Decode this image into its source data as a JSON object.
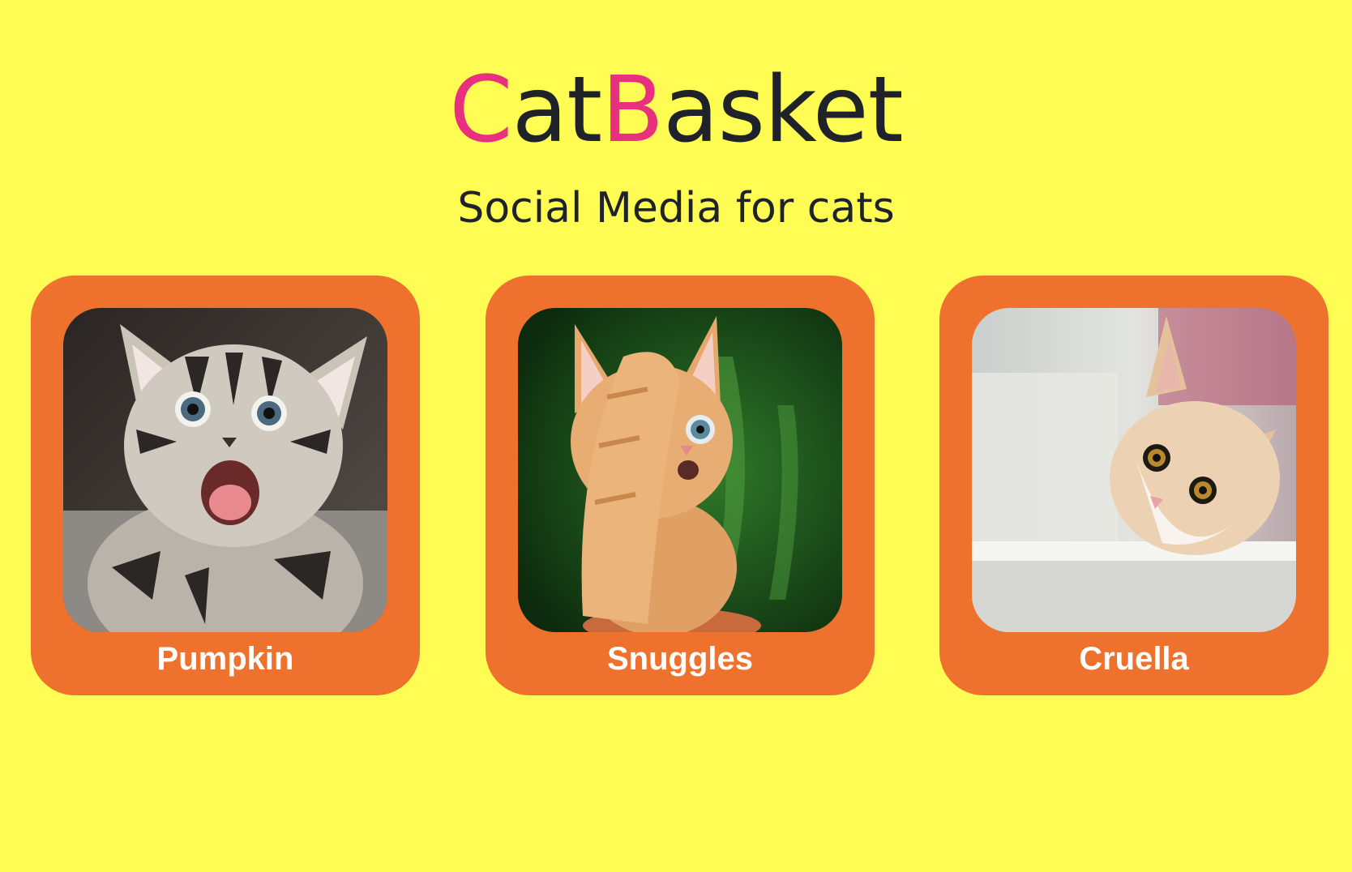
{
  "header": {
    "brand_c": "C",
    "brand_at": "at",
    "brand_b": "B",
    "brand_asket": "asket",
    "tagline": "Social Media for cats"
  },
  "cats": [
    {
      "name": "Pumpkin"
    },
    {
      "name": "Snuggles"
    },
    {
      "name": "Cruella"
    }
  ],
  "colors": {
    "background": "#fffd54",
    "card": "#ee722e",
    "brand_accent": "#e8307e",
    "text": "#1f2329"
  },
  "images": [
    "tabby-kitten-photo",
    "orange-kitten-photo",
    "cream-cat-photo"
  ]
}
